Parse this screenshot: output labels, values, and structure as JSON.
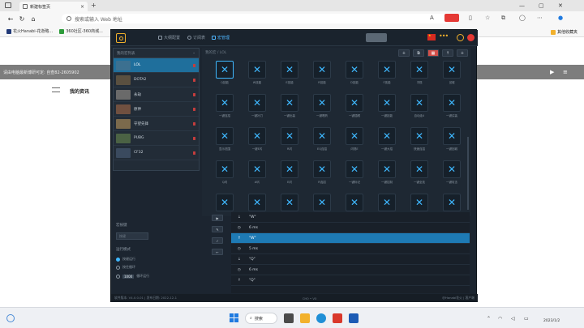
{
  "browser": {
    "tab_title": "新建标签页",
    "address_placeholder": "搜索或输入 Web 地址",
    "favorites": [
      {
        "label": "花火Hanabi-花逝略..."
      },
      {
        "label": "360社区-360商城..."
      }
    ],
    "other_favorites": "其他收藏夹"
  },
  "page": {
    "gray_banner_text": "请由电脑最新博研可定: 自查82-2605902",
    "my_info": "我的资讯"
  },
  "app": {
    "tabs": [
      {
        "label": "大纲配置"
      },
      {
        "label": "订阅表"
      },
      {
        "label": "宏管理"
      }
    ],
    "list_header": "我的宏列表",
    "list": [
      {
        "label": "LOL",
        "selected": true
      },
      {
        "label": "DOTA2"
      },
      {
        "label": "永劫"
      },
      {
        "label": "原神"
      },
      {
        "label": "守望先锋"
      },
      {
        "label": "PUBG"
      },
      {
        "label": "CF32"
      }
    ],
    "grid_breadcrumb": "我的宏 / LOL",
    "toolbar": {
      "add": "+",
      "copy": "⧉",
      "delete": "▦",
      "up": "↑",
      "plus": "+"
    },
    "keys": [
      {
        "label": "Q技能",
        "selected": true
      },
      {
        "label": "W技能"
      },
      {
        "label": "E技能"
      },
      {
        "label": "R技能"
      },
      {
        "label": "D技能"
      },
      {
        "label": "F技能"
      },
      {
        "label": "闪现"
      },
      {
        "label": "回城"
      },
      {
        "label": "一键连招"
      },
      {
        "label": "一键补刀"
      },
      {
        "label": "一键出装"
      },
      {
        "label": "一键喝药"
      },
      {
        "label": "一键插眼"
      },
      {
        "label": "一键技能"
      },
      {
        "label": "自动走A"
      },
      {
        "label": "一键买装"
      },
      {
        "label": "显示范围"
      },
      {
        "label": "一键E闪"
      },
      {
        "label": "R闪"
      },
      {
        "label": "EQ连招"
      },
      {
        "label": "闪现E"
      },
      {
        "label": "一键大招"
      },
      {
        "label": "快速连招"
      },
      {
        "label": "一键回城"
      },
      {
        "label": "Q闪"
      },
      {
        "label": "W闪"
      },
      {
        "label": "E闪"
      },
      {
        "label": "R连招"
      },
      {
        "label": "一键标记"
      },
      {
        "label": "一键控制"
      },
      {
        "label": "一键全技"
      },
      {
        "label": "一键攻击"
      },
      {
        "label": ""
      },
      {
        "label": ""
      },
      {
        "label": ""
      },
      {
        "label": ""
      },
      {
        "label": ""
      },
      {
        "label": ""
      },
      {
        "label": ""
      },
      {
        "label": ""
      }
    ],
    "bottom": {
      "trigger_label": "宏按键",
      "trigger_input": "按键",
      "run_mode_label": "运行模式",
      "modes": [
        {
          "label": "按键运行",
          "on": true
        },
        {
          "label": "按住循环",
          "value": ""
        },
        {
          "label": "循环运行",
          "value": "1000"
        }
      ]
    },
    "sequence": [
      {
        "icon": "↓",
        "text": "\"W\""
      },
      {
        "icon": "◷",
        "text": "6 ms"
      },
      {
        "icon": "↑",
        "text": "\"W\"",
        "selected": true
      },
      {
        "icon": "◷",
        "text": "5 ms"
      },
      {
        "icon": "↓",
        "text": "\"Q\""
      },
      {
        "icon": "◷",
        "text": "6 ms"
      },
      {
        "icon": "↑",
        "text": "\"Q\""
      }
    ],
    "status": {
      "left": "软件版本: V4.0.0.01 | 发布日期: 2022-12-1",
      "center": "CH0 • V0",
      "right": "@Hanabi花火 | 客户端"
    }
  },
  "taskbar": {
    "search": "搜索",
    "time": "",
    "date": "2023/1/2"
  }
}
